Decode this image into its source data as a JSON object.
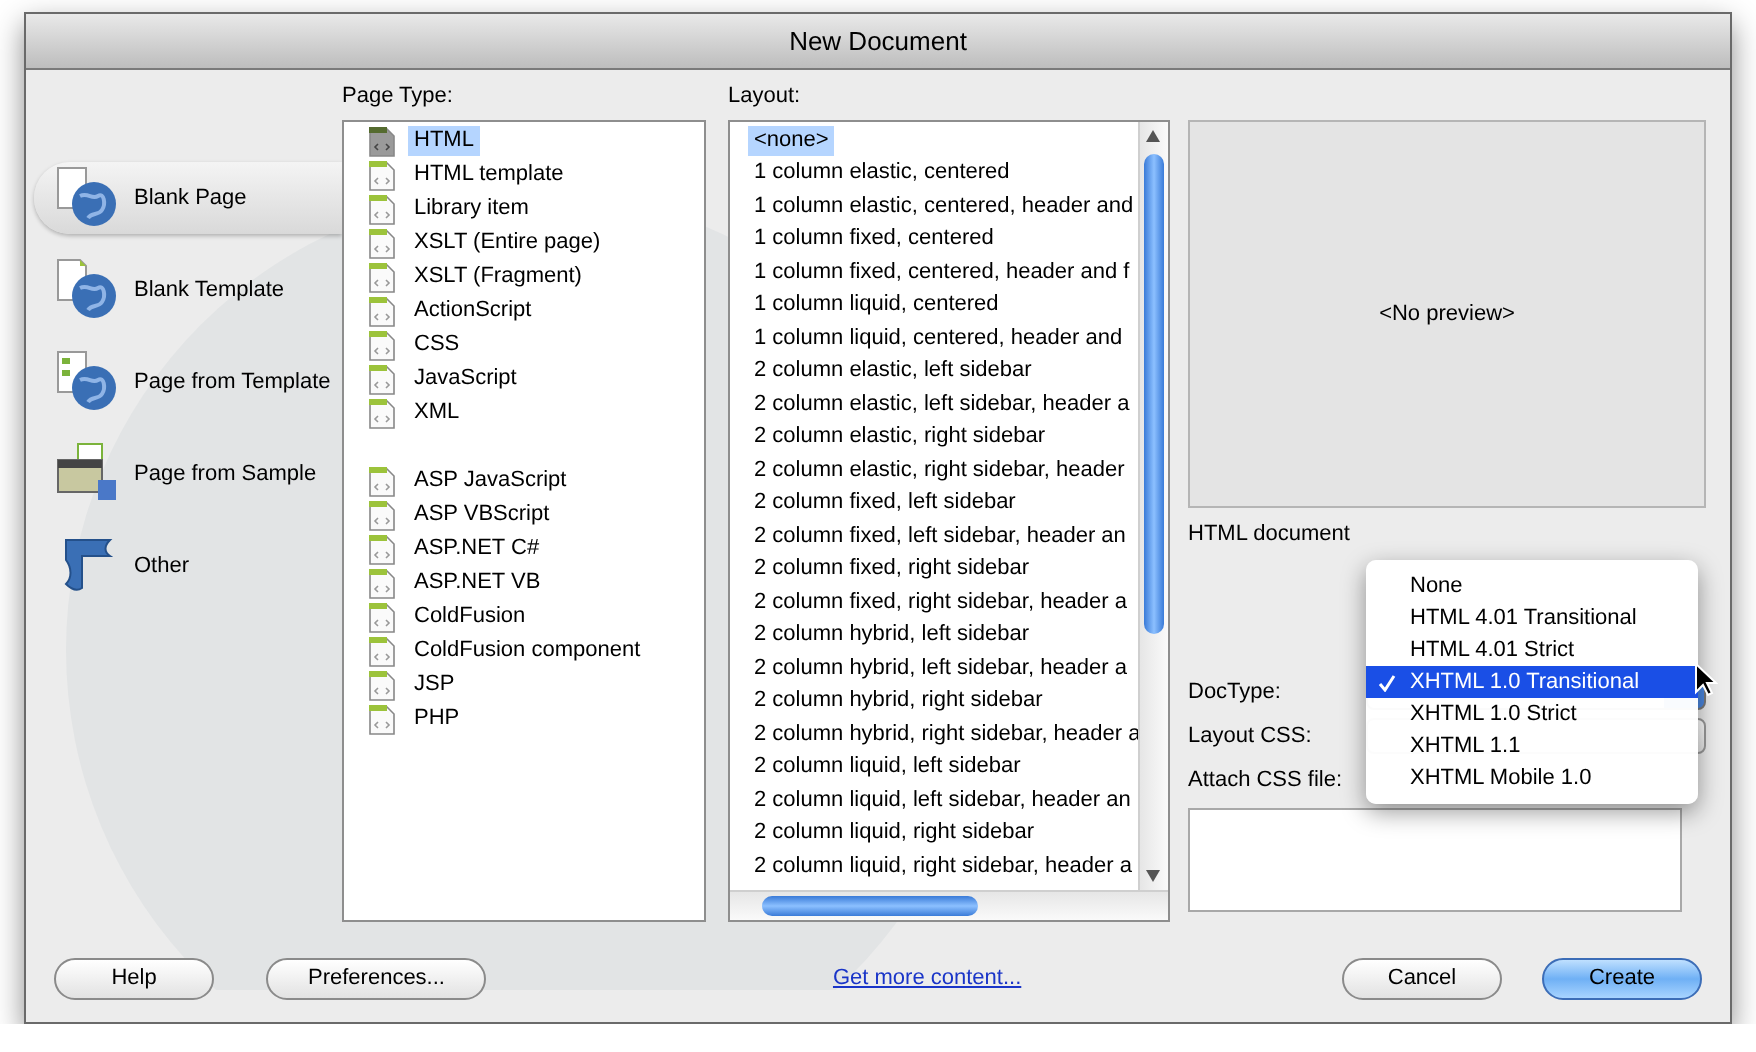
{
  "window": {
    "title": "New Document"
  },
  "sidebar": {
    "items": [
      {
        "label": "Blank Page",
        "kind": "page",
        "selected": true
      },
      {
        "label": "Blank Template",
        "kind": "template",
        "selected": false
      },
      {
        "label": "Page from Template",
        "kind": "from-template",
        "selected": false
      },
      {
        "label": "Page from Sample",
        "kind": "sample",
        "selected": false
      },
      {
        "label": "Other",
        "kind": "other",
        "selected": false
      }
    ]
  },
  "page_type": {
    "label": "Page Type:",
    "groups": [
      [
        {
          "label": "HTML",
          "selected": true
        },
        {
          "label": "HTML template",
          "selected": false
        },
        {
          "label": "Library item",
          "selected": false
        },
        {
          "label": "XSLT (Entire page)",
          "selected": false
        },
        {
          "label": "XSLT (Fragment)",
          "selected": false
        },
        {
          "label": "ActionScript",
          "selected": false
        },
        {
          "label": "CSS",
          "selected": false
        },
        {
          "label": "JavaScript",
          "selected": false
        },
        {
          "label": "XML",
          "selected": false
        }
      ],
      [
        {
          "label": "ASP JavaScript",
          "selected": false
        },
        {
          "label": "ASP VBScript",
          "selected": false
        },
        {
          "label": "ASP.NET C#",
          "selected": false
        },
        {
          "label": "ASP.NET VB",
          "selected": false
        },
        {
          "label": "ColdFusion",
          "selected": false
        },
        {
          "label": "ColdFusion component",
          "selected": false
        },
        {
          "label": "JSP",
          "selected": false
        },
        {
          "label": "PHP",
          "selected": false
        }
      ]
    ]
  },
  "layout": {
    "label": "Layout:",
    "items": [
      {
        "label": "<none>",
        "selected": true
      },
      {
        "label": "1 column elastic, centered",
        "selected": false
      },
      {
        "label": "1 column elastic, centered, header and",
        "selected": false
      },
      {
        "label": "1 column fixed, centered",
        "selected": false
      },
      {
        "label": "1 column fixed, centered, header and f",
        "selected": false
      },
      {
        "label": "1 column liquid, centered",
        "selected": false
      },
      {
        "label": "1 column liquid, centered, header and",
        "selected": false
      },
      {
        "label": "2 column elastic, left sidebar",
        "selected": false
      },
      {
        "label": "2 column elastic, left sidebar, header a",
        "selected": false
      },
      {
        "label": "2 column elastic, right sidebar",
        "selected": false
      },
      {
        "label": "2 column elastic, right sidebar, header",
        "selected": false
      },
      {
        "label": "2 column fixed, left sidebar",
        "selected": false
      },
      {
        "label": "2 column fixed, left sidebar, header an",
        "selected": false
      },
      {
        "label": "2 column fixed, right sidebar",
        "selected": false
      },
      {
        "label": "2 column fixed, right sidebar, header a",
        "selected": false
      },
      {
        "label": "2 column hybrid, left sidebar",
        "selected": false
      },
      {
        "label": "2 column hybrid, left sidebar, header a",
        "selected": false
      },
      {
        "label": "2 column hybrid, right sidebar",
        "selected": false
      },
      {
        "label": "2 column hybrid, right sidebar, header a",
        "selected": false
      },
      {
        "label": "2 column liquid, left sidebar",
        "selected": false
      },
      {
        "label": "2 column liquid, left sidebar, header an",
        "selected": false
      },
      {
        "label": "2 column liquid, right sidebar",
        "selected": false
      },
      {
        "label": "2 column liquid, right sidebar, header a",
        "selected": false
      }
    ]
  },
  "preview": {
    "text": "<No preview>",
    "description": "HTML document"
  },
  "doctype": {
    "label": "DocType:",
    "menu": [
      {
        "label": "None",
        "selected": false
      },
      {
        "label": "HTML 4.01 Transitional",
        "selected": false
      },
      {
        "label": "HTML 4.01 Strict",
        "selected": false
      },
      {
        "label": "XHTML 1.0 Transitional",
        "selected": true
      },
      {
        "label": "XHTML 1.0 Strict",
        "selected": false
      },
      {
        "label": "XHTML 1.1",
        "selected": false
      },
      {
        "label": "XHTML Mobile 1.0",
        "selected": false
      }
    ]
  },
  "layout_css": {
    "label": "Layout CSS:"
  },
  "attach_css": {
    "label": "Attach CSS file:"
  },
  "footer": {
    "left_buttons": [
      {
        "label": "Help",
        "primary": false
      },
      {
        "label": "Preferences...",
        "primary": false
      }
    ],
    "link": "Get more content...",
    "right_buttons": [
      {
        "label": "Cancel",
        "primary": false
      },
      {
        "label": "Create",
        "primary": true
      }
    ]
  }
}
